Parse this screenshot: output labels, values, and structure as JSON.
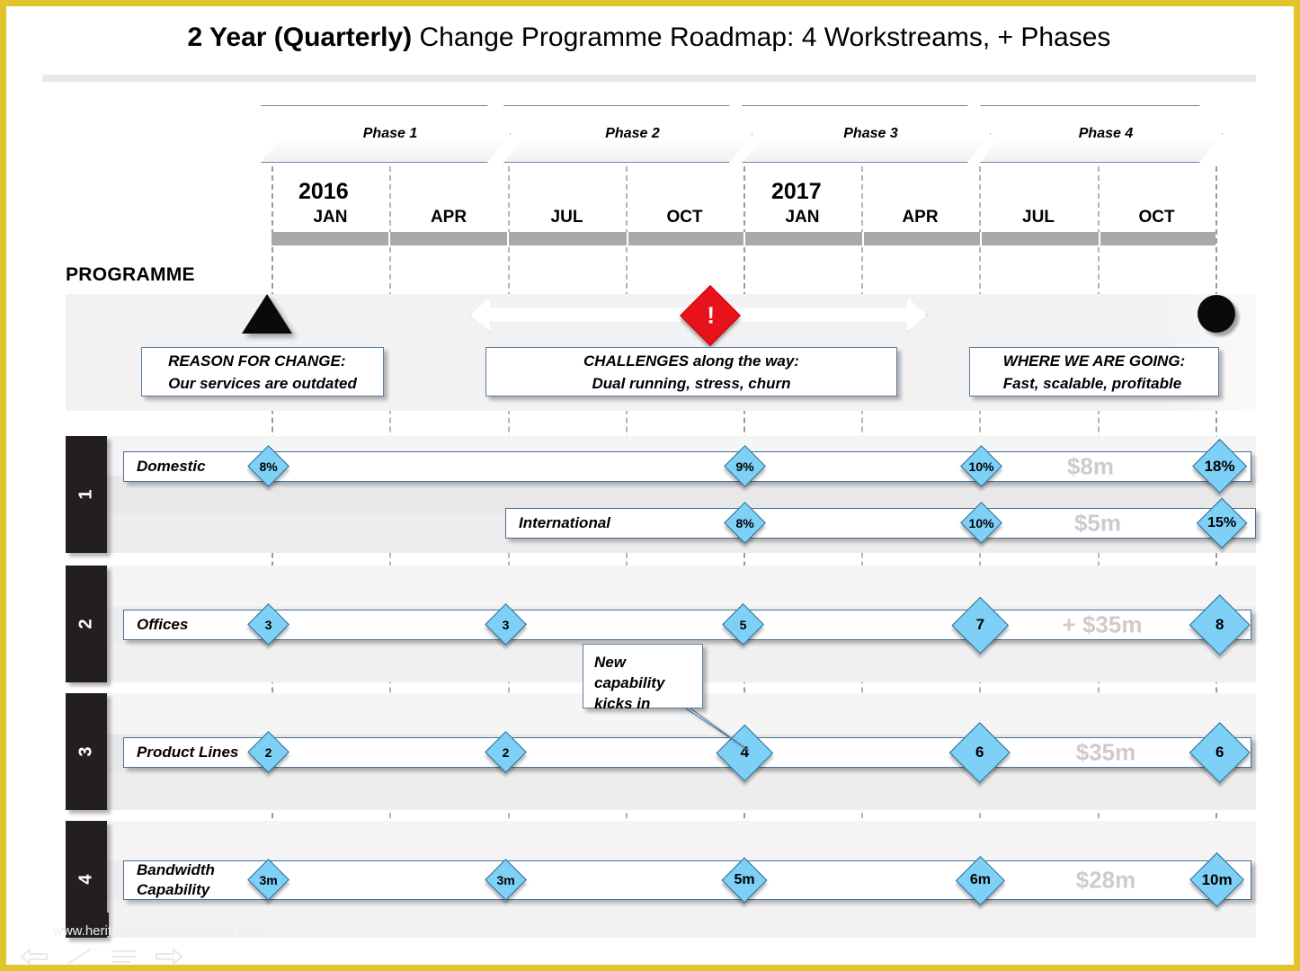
{
  "title": {
    "bold_part": "2 Year (Quarterly)",
    "rest_part": " Change Programme Roadmap: 4 Workstreams, + Phases"
  },
  "phases": [
    {
      "label": "Phase 1"
    },
    {
      "label": "Phase 2"
    },
    {
      "label": "Phase 3"
    },
    {
      "label": "Phase 4"
    }
  ],
  "timeline": {
    "years": [
      "2016",
      "2017"
    ],
    "months": [
      "JAN",
      "APR",
      "JUL",
      "OCT",
      "JAN",
      "APR",
      "JUL",
      "OCT"
    ]
  },
  "programme": {
    "heading": "PROGRAMME",
    "start_milestone_icon": "triangle-milestone",
    "end_milestone_icon": "circle-milestone",
    "alert_icon": "exclamation-diamond-icon",
    "alert_symbol": "!",
    "boxes": [
      {
        "line1": "REASON FOR CHANGE:",
        "line2": "Our services are outdated"
      },
      {
        "line1": "CHALLENGES along the way:",
        "line2": "Dual running, stress, churn"
      },
      {
        "line1": "WHERE WE ARE GOING:",
        "line2": "Fast, scalable, profitable"
      }
    ]
  },
  "callout": {
    "line1": "New",
    "line2": "capability",
    "line3": "kicks in"
  },
  "workstreams": [
    {
      "number": "1",
      "bars": [
        {
          "label_line1": "Domestic",
          "label_line2": "",
          "total": "$8m",
          "milestones": [
            {
              "value": "8%"
            },
            {
              "value": "9%"
            },
            {
              "value": "10%"
            },
            {
              "value": "18%"
            }
          ]
        },
        {
          "label_line1": "International",
          "label_line2": "",
          "total": "$5m",
          "milestones": [
            {
              "value": "8%"
            },
            {
              "value": "10%"
            },
            {
              "value": "15%"
            }
          ]
        }
      ]
    },
    {
      "number": "2",
      "bars": [
        {
          "label_line1": "Offices",
          "label_line2": "",
          "total": "+ $35m",
          "milestones": [
            {
              "value": "3"
            },
            {
              "value": "3"
            },
            {
              "value": "5"
            },
            {
              "value": "7"
            },
            {
              "value": "8"
            }
          ]
        }
      ]
    },
    {
      "number": "3",
      "bars": [
        {
          "label_line1": "Product Lines",
          "label_line2": "",
          "total": "$35m",
          "milestones": [
            {
              "value": "2"
            },
            {
              "value": "2"
            },
            {
              "value": "4"
            },
            {
              "value": "6"
            },
            {
              "value": "6"
            }
          ]
        }
      ]
    },
    {
      "number": "4",
      "bars": [
        {
          "label_line1": "Bandwidth",
          "label_line2": "Capability",
          "total": "$28m",
          "milestones": [
            {
              "value": "3m"
            },
            {
              "value": "3m"
            },
            {
              "value": "5m"
            },
            {
              "value": "6m"
            },
            {
              "value": "10m"
            }
          ]
        }
      ]
    }
  ],
  "footer": {
    "watermark": "www.heritagedmotionhotmage.com",
    "icons": [
      "back-arrow-icon",
      "pen-icon",
      "lines-icon",
      "forward-arrow-icon"
    ]
  },
  "colors": {
    "diamond_fill": "#7fd0f7",
    "diamond_stroke": "#2a6b95",
    "alert_red": "#e8121a",
    "tab_black": "#231f20",
    "frame_yellow": "#e2c52c",
    "total_gray": "#cccccc"
  }
}
